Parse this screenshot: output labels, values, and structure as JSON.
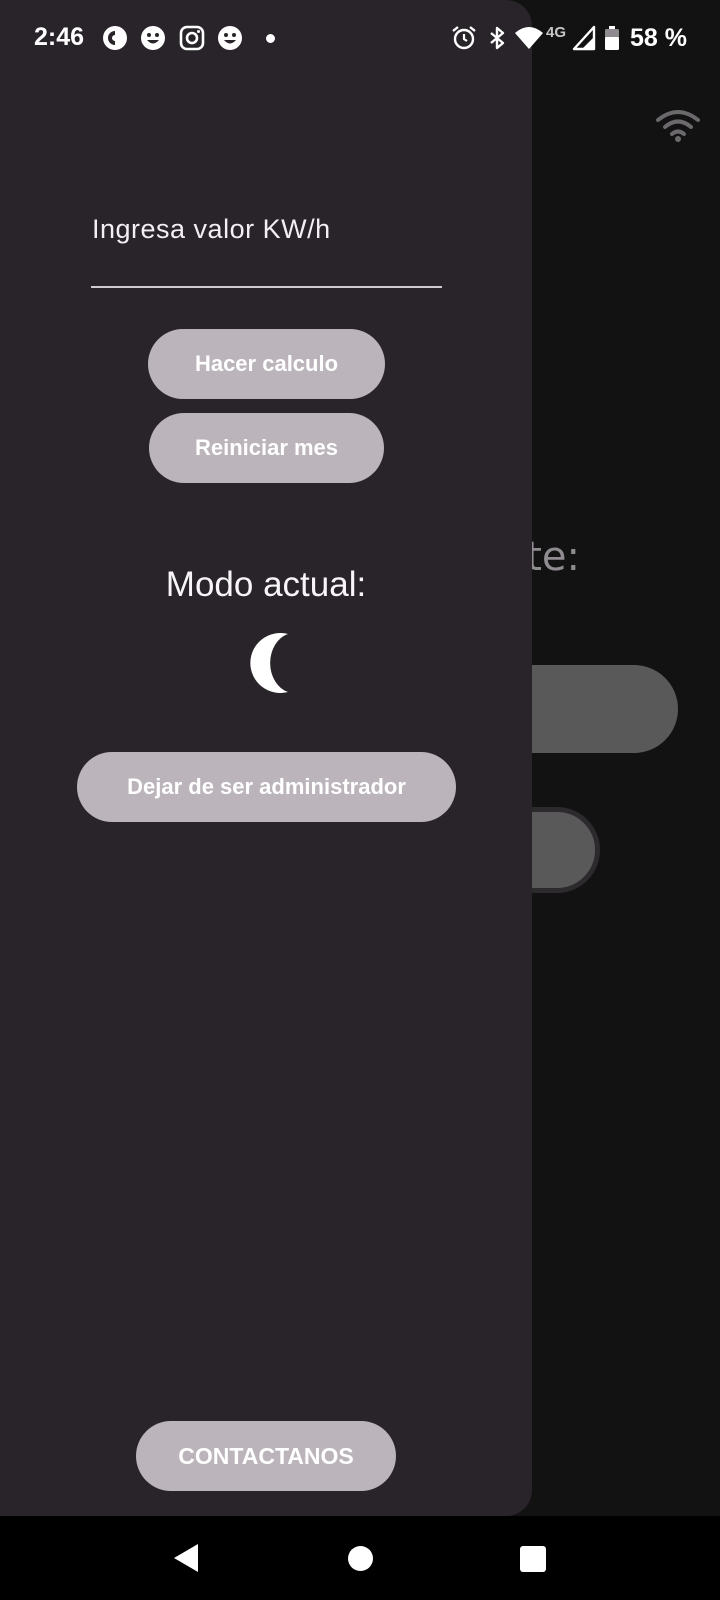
{
  "status_bar": {
    "time": "2:46",
    "network_label": "4G",
    "battery": "58 %",
    "left_icons": [
      "sync-icon",
      "face-icon",
      "instagram-icon",
      "face-icon",
      "dot-icon"
    ],
    "right_icons": [
      "alarm-icon",
      "bluetooth-icon",
      "wifi-icon",
      "signal-icon",
      "battery-icon"
    ]
  },
  "drawer": {
    "kwh_field": {
      "label": "Ingresa valor KW/h",
      "value": ""
    },
    "calc_button": "Hacer calculo",
    "reset_button": "Reiniciar mes",
    "mode_title": "Modo actual:",
    "mode_icon": "moon-icon",
    "admin_button": "Dejar de ser administrador",
    "contact_button": "CONTACTANOS"
  },
  "background": {
    "partial_label": "te:",
    "icon": "wifi-icon"
  },
  "colors": {
    "drawer_bg": "#29242a",
    "app_bg": "#131213",
    "button_bg": "#bbb5bb",
    "nav_bg": "#000000"
  }
}
